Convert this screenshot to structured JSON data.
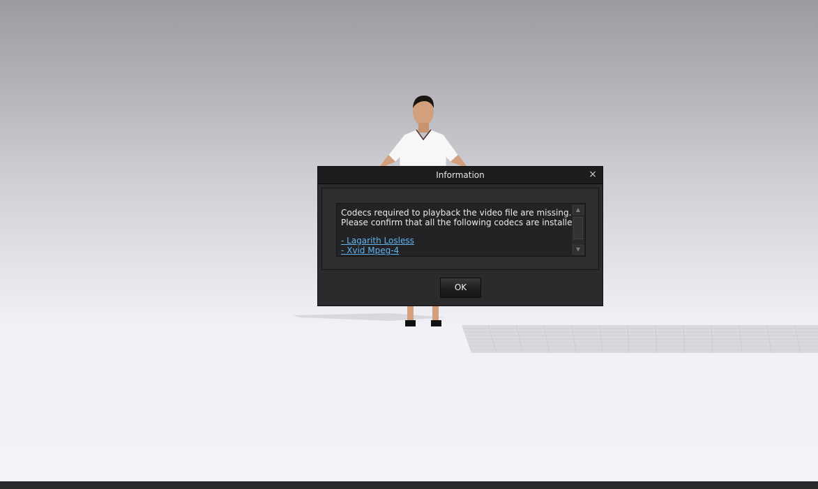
{
  "dialog": {
    "title": "Information",
    "close_glyph": "×",
    "message_lines": [
      "Codecs required to playback the video file are missing.",
      "Please confirm that all the following codecs are installed:"
    ],
    "codec_links": [
      "- Lagarith Losless",
      "- Xvid Mpeg-4"
    ],
    "scroll_up_glyph": "▲",
    "scroll_down_glyph": "▼",
    "ok_label": "OK"
  },
  "colors": {
    "link": "#5fb4f0",
    "dialog_bg": "#2b2b2d",
    "titlebar_bg": "#1c1c1e"
  },
  "icons": [
    "close-icon",
    "scroll-up-arrow-icon",
    "scroll-down-arrow-icon"
  ]
}
